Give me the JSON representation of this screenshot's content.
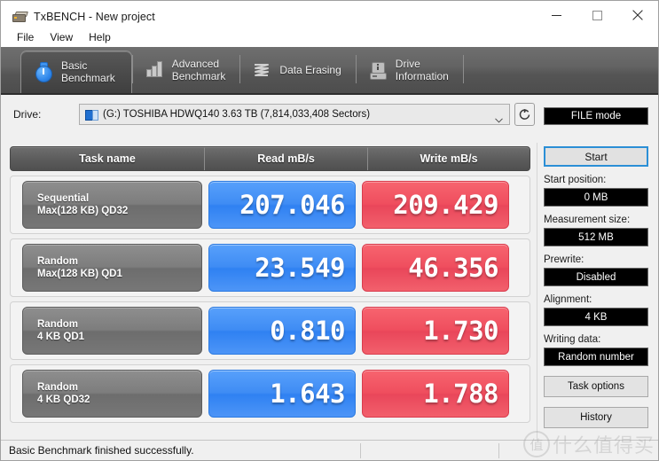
{
  "window": {
    "title": "TxBENCH - New project",
    "app_icon": "drive-app-icon",
    "controls": {
      "minimize": "—",
      "maximize": "□",
      "close": "✕"
    }
  },
  "menu": {
    "items": [
      "File",
      "View",
      "Help"
    ]
  },
  "tabs": [
    {
      "label_line1": "Basic",
      "label_line2": "Benchmark",
      "icon": "stopwatch-icon",
      "active": true
    },
    {
      "label_line1": "Advanced",
      "label_line2": "Benchmark",
      "icon": "bar-chart-icon",
      "active": false
    },
    {
      "label_line1": "Data Erasing",
      "label_line2": "",
      "icon": "shredder-icon",
      "active": false
    },
    {
      "label_line1": "Drive",
      "label_line2": "Information",
      "icon": "hard-drive-icon",
      "active": false
    }
  ],
  "drive": {
    "label": "Drive:",
    "selected": "(G:) TOSHIBA HDWQ140  3.63 TB (7,814,033,408 Sectors)",
    "refresh_icon": "refresh-icon",
    "mode_button": "FILE mode"
  },
  "results": {
    "columns": [
      "Task name",
      "Read mB/s",
      "Write mB/s"
    ],
    "rows": [
      {
        "task_line1": "Sequential",
        "task_line2": "Max(128 KB) QD32",
        "read": "207.046",
        "write": "209.429"
      },
      {
        "task_line1": "Random",
        "task_line2": "Max(128 KB) QD1",
        "read": "23.549",
        "write": "46.356"
      },
      {
        "task_line1": "Random",
        "task_line2": "4 KB QD1",
        "read": "0.810",
        "write": "1.730"
      },
      {
        "task_line1": "Random",
        "task_line2": "4 KB QD32",
        "read": "1.643",
        "write": "1.788"
      }
    ]
  },
  "sidebar": {
    "start_button": "Start",
    "fields": [
      {
        "label": "Start position:",
        "value": "0 MB"
      },
      {
        "label": "Measurement size:",
        "value": "512 MB"
      },
      {
        "label": "Prewrite:",
        "value": "Disabled"
      },
      {
        "label": "Alignment:",
        "value": "4 KB"
      },
      {
        "label": "Writing data:",
        "value": "Random number"
      }
    ],
    "buttons": [
      "Task options",
      "History"
    ]
  },
  "status": {
    "message": "Basic Benchmark finished successfully."
  },
  "watermark": {
    "mark": "值",
    "text": "什么值得买"
  },
  "colors": {
    "read_accent": "#3f8cf4",
    "write_accent": "#ef4e5e",
    "start_focus": "#2b8fd6",
    "tabstrip": "#636363"
  }
}
